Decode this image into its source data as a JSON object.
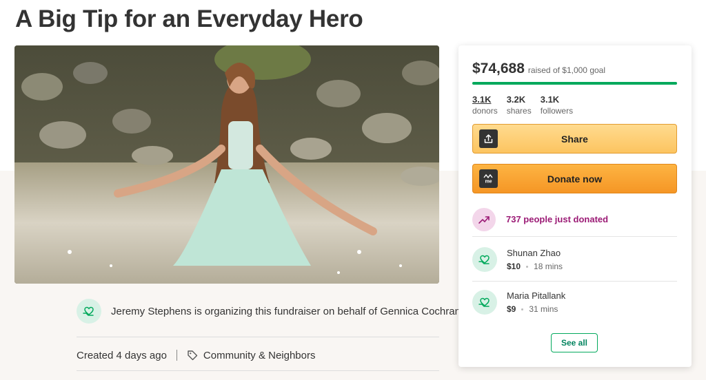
{
  "page": {
    "title": "A Big Tip for an Everyday Hero"
  },
  "organizer": {
    "text": "Jeremy Stephens is organizing this fundraiser on behalf of Gennica Cochran."
  },
  "meta": {
    "created": "Created 4 days ago",
    "category": "Community & Neighbors"
  },
  "donation_card": {
    "raised_amount": "$74,688",
    "raised_goal_text": "raised of $1,000 goal",
    "progress_fraction": 1.0,
    "stats": [
      {
        "value": "3.1K",
        "label": "donors"
      },
      {
        "value": "3.2K",
        "label": "shares"
      },
      {
        "value": "3.1K",
        "label": "followers"
      }
    ],
    "share_label": "Share",
    "donate_label": "Donate now",
    "recent_text": "737 people just donated",
    "donors": [
      {
        "name": "Shunan Zhao",
        "amount": "$10",
        "time": "18 mins"
      },
      {
        "name": "Maria Pitallank",
        "amount": "$9",
        "time": "31 mins"
      }
    ],
    "see_all_label": "See all"
  },
  "colors": {
    "accent_green": "#02a95c",
    "button_orange": "#f59625",
    "trend_purple": "#9b1a75"
  },
  "icons": {
    "share_button": "share-upload-icon",
    "donate_button": "gofundme-logo-icon",
    "trend": "trending-up-icon",
    "donor": "heart-hand-icon",
    "category": "tag-icon"
  }
}
